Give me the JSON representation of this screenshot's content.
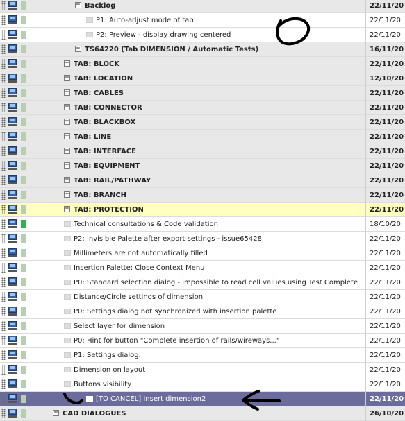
{
  "rows": [
    {
      "label": "Backlog",
      "date": "22/11/20",
      "expander": "−"
    },
    {
      "label": "P1: Auto-adjust mode of tab",
      "date": "22/11/20"
    },
    {
      "label": "P2: Preview - display drawing centered",
      "date": "22/11/20"
    },
    {
      "label": "TS64220 (Tab DIMENSION / Automatic Tests)",
      "date": "16/11/20",
      "expander": "+"
    },
    {
      "label": "TAB: BLOCK",
      "date": "22/11/20",
      "expander": "+"
    },
    {
      "label": "TAB: LOCATION",
      "date": "12/10/20",
      "expander": "+"
    },
    {
      "label": "TAB: CABLES",
      "date": "22/11/20",
      "expander": "+"
    },
    {
      "label": "TAB: CONNECTOR",
      "date": "22/11/20",
      "expander": "+"
    },
    {
      "label": "TAB: BLACKBOX",
      "date": "22/11/20",
      "expander": "+"
    },
    {
      "label": "TAB: LINE",
      "date": "22/11/20",
      "expander": "+"
    },
    {
      "label": "TAB: INTERFACE",
      "date": "22/11/20",
      "expander": "+"
    },
    {
      "label": "TAB: EQUIPMENT",
      "date": "22/11/20",
      "expander": "+"
    },
    {
      "label": "TAB: RAIL/PATHWAY",
      "date": "22/11/20",
      "expander": "+"
    },
    {
      "label": "TAB: BRANCH",
      "date": "22/11/20",
      "expander": "+"
    },
    {
      "label": "TAB: PROTECTION",
      "date": "22/11/20",
      "expander": "+"
    },
    {
      "label": "Technical consultations & Code validation",
      "date": "18/10/20"
    },
    {
      "label": "P2: Invisible Palette after export settings - issue65428",
      "date": "22/11/20"
    },
    {
      "label": "Millimeters are not automatically filled",
      "date": "22/11/20"
    },
    {
      "label": "Insertion Palette: Close Context Menu",
      "date": "22/11/20"
    },
    {
      "label": "P0: Standard selection dialog - impossible to read cell values using Test Complete",
      "date": "22/11/20"
    },
    {
      "label": "Distance/Circle settings of dimension",
      "date": "22/11/20"
    },
    {
      "label": "P0: Settings dialog not synchronized with insertion palette",
      "date": "22/11/20"
    },
    {
      "label": "Select layer for dimension",
      "date": "22/11/20"
    },
    {
      "label": "P0: Hint for button \"Complete insertion of rails/wireways...\"",
      "date": "22/11/20"
    },
    {
      "label": "P1: Settings dialog.",
      "date": "22/11/20"
    },
    {
      "label": "Dimension on layout",
      "date": "22/11/20"
    },
    {
      "label": "Buttons visibility",
      "date": "22/11/20"
    },
    {
      "label": "[TO CANCEL] Insert dimension2",
      "date": "22/11/20"
    },
    {
      "label": "CAD DIALOGUES",
      "date": "26/10/20",
      "expander": "+"
    }
  ],
  "colors": {
    "group_row": "#e8e8e8",
    "highlight_row": "#ffffc0",
    "selected_row": "#6c6c9c",
    "status_green": "#2fb34a",
    "status_pale": "#b6cfb2"
  }
}
